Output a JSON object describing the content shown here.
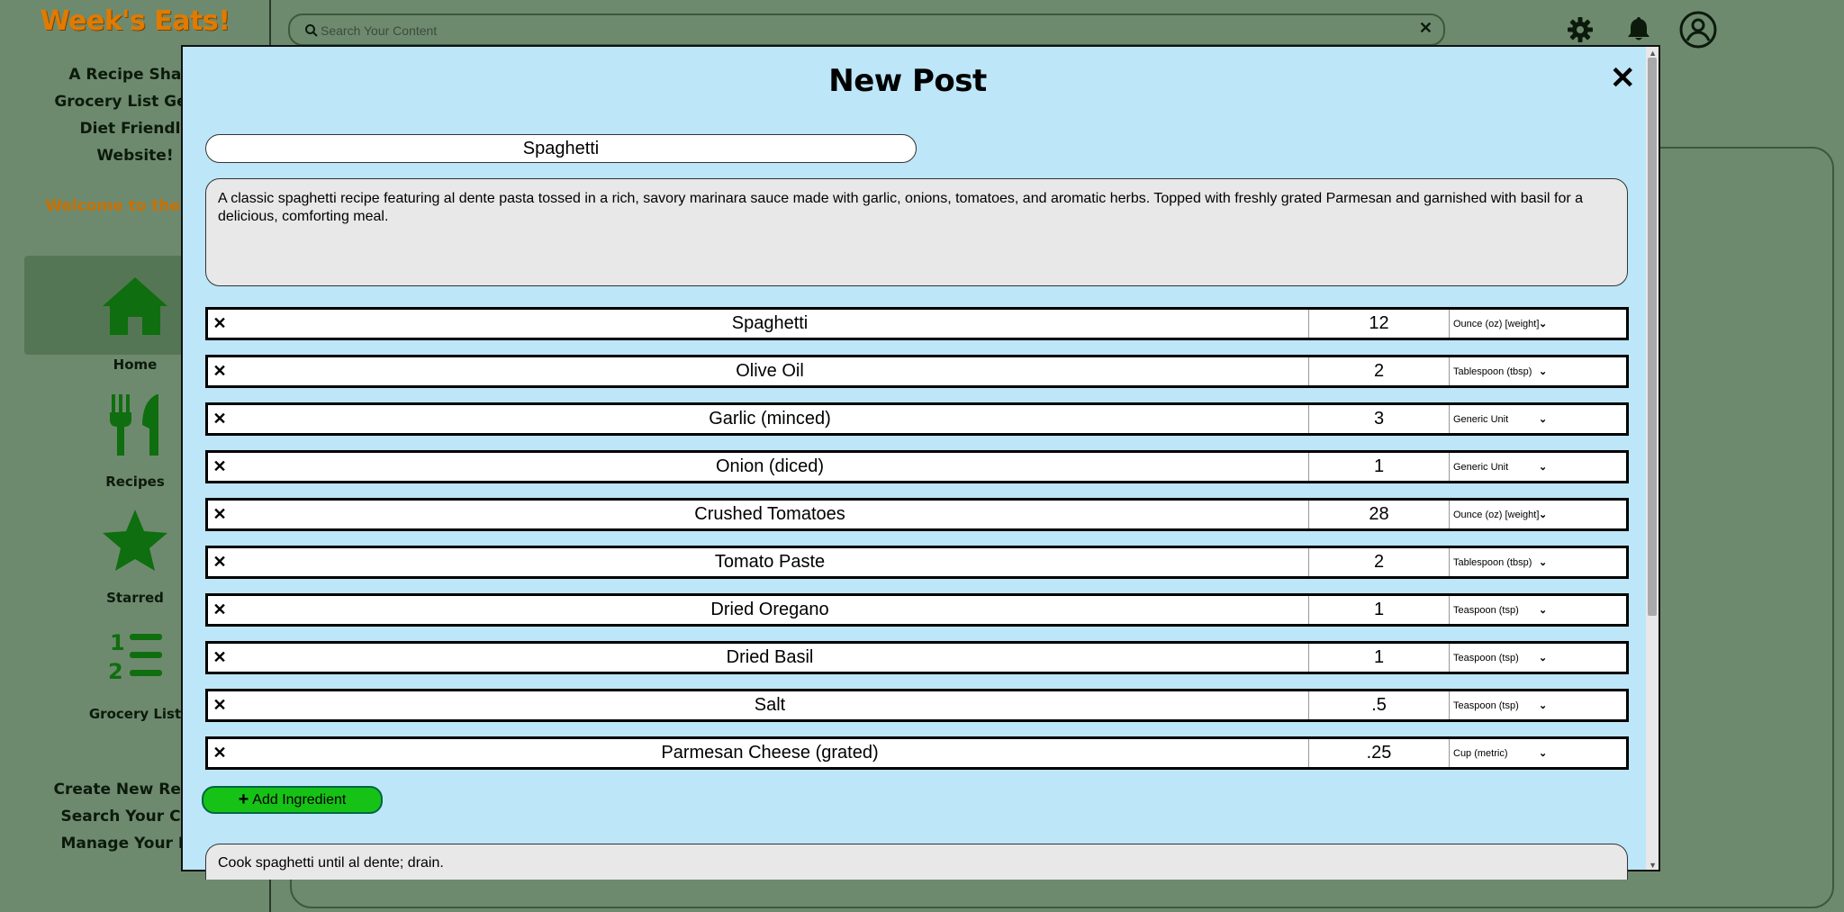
{
  "sidebar": {
    "brand": "Week's Eats!",
    "tagline": [
      "A Recipe Sharit",
      "Grocery List Gener",
      "Diet Friendly",
      "Website!"
    ],
    "welcome": "Welcome to the Hom",
    "nav": [
      {
        "label": "Home",
        "icon": "home-icon"
      },
      {
        "label": "Recipes",
        "icon": "utensils-icon"
      },
      {
        "label": "Starred",
        "icon": "star-icon"
      },
      {
        "label": "Grocery List",
        "icon": "list-ol-icon"
      }
    ],
    "links": [
      "Create New Recipe",
      "Search Your Cont",
      "Manage Your Rec"
    ]
  },
  "header": {
    "search_placeholder": "Search Your Content",
    "clear_symbol": "✕",
    "icons": [
      "gear-icon",
      "bell-icon",
      "user-circle-icon"
    ]
  },
  "modal": {
    "title": "New Post",
    "close_symbol": "✕",
    "post_title": "Spaghetti",
    "description": "A classic spaghetti recipe featuring al dente pasta tossed in a rich, savory marinara sauce made with garlic, onions, tomatoes, and aromatic herbs. Topped with freshly grated Parmesan and garnished with basil for a delicious, comforting meal.",
    "ingredients": [
      {
        "name": "Spaghetti",
        "qty": "12",
        "unit": "Ounce (oz) [weight]"
      },
      {
        "name": "Olive Oil",
        "qty": "2",
        "unit": "Tablespoon (tbsp)"
      },
      {
        "name": "Garlic (minced)",
        "qty": "3",
        "unit": "Generic Unit"
      },
      {
        "name": "Onion (diced)",
        "qty": "1",
        "unit": "Generic Unit"
      },
      {
        "name": "Crushed Tomatoes",
        "qty": "28",
        "unit": "Ounce (oz) [weight]"
      },
      {
        "name": "Tomato Paste",
        "qty": "2",
        "unit": "Tablespoon (tbsp)"
      },
      {
        "name": "Dried Oregano",
        "qty": "1",
        "unit": "Teaspoon (tsp)"
      },
      {
        "name": "Dried Basil",
        "qty": "1",
        "unit": "Teaspoon (tsp)"
      },
      {
        "name": "Salt",
        "qty": ".5",
        "unit": "Teaspoon (tsp)"
      },
      {
        "name": "Parmesan Cheese (grated)",
        "qty": ".25",
        "unit": "Cup (metric)"
      }
    ],
    "remove_symbol": "✕",
    "add_ingredient_label": "Add Ingredient",
    "first_step": "Cook spaghetti until al dente; drain."
  },
  "colors": {
    "background": "#6e8a6e",
    "brand": "#e07b00",
    "modal_bg": "#bde6f8",
    "add_button": "#17c217",
    "icon_green": "#0f6e0f"
  }
}
